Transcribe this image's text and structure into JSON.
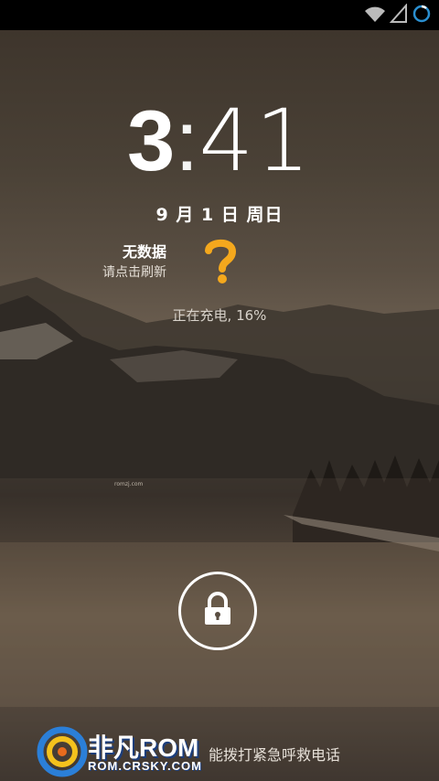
{
  "status": {
    "wifi_icon": "wifi-icon",
    "signal_icon": "signal-icon",
    "battery_icon": "battery-charging-icon"
  },
  "clock": {
    "hours": "3",
    "colon": ":",
    "minutes": "41"
  },
  "date": "9 月 1 日 周日",
  "weather": {
    "title": "无数据",
    "subtitle": "请点击刷新",
    "icon": "question-mark-icon",
    "icon_color": "#f4a81d"
  },
  "charging_text": "正在充电, 16%",
  "watermark_small": "romzj.com",
  "emergency_text": "能拨打紧急呼救电话",
  "brand": {
    "name": "非凡ROM",
    "url": "ROM.CRSKY.COM"
  },
  "colors": {
    "accent": "#f4a81d",
    "ring": "#ffffff"
  }
}
